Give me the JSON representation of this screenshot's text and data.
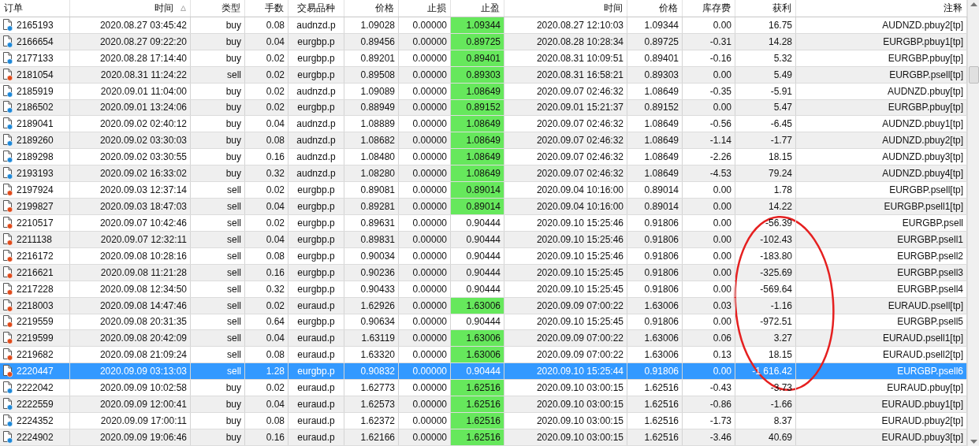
{
  "columns": [
    {
      "label": "订单",
      "sort": false
    },
    {
      "label": "时间",
      "sort": true
    },
    {
      "label": "类型",
      "sort": false
    },
    {
      "label": "手数",
      "sort": false
    },
    {
      "label": "交易品种",
      "sort": false
    },
    {
      "label": "价格",
      "sort": false
    },
    {
      "label": "止损",
      "sort": false
    },
    {
      "label": "止盈",
      "sort": false
    },
    {
      "label": "时间",
      "sort": false
    },
    {
      "label": "价格",
      "sort": false
    },
    {
      "label": "库存费",
      "sort": false
    },
    {
      "label": "获利",
      "sort": false
    },
    {
      "label": "注释",
      "sort": false
    }
  ],
  "rows": [
    {
      "kind": "buy",
      "tp_hit": true,
      "selected": false,
      "cells": [
        "2165193",
        "2020.08.27 03:45:42",
        "buy",
        "0.08",
        "audnzd.p",
        "1.09028",
        "0.00000",
        "1.09344",
        "2020.08.27 12:10:03",
        "1.09344",
        "0.00",
        "16.75",
        "AUDNZD.pbuy2[tp]"
      ]
    },
    {
      "kind": "buy",
      "tp_hit": true,
      "selected": false,
      "cells": [
        "2166654",
        "2020.08.27 09:22:20",
        "buy",
        "0.04",
        "eurgbp.p",
        "0.89456",
        "0.00000",
        "0.89725",
        "2020.08.28 10:28:34",
        "0.89725",
        "-0.31",
        "14.28",
        "EURGBP.pbuy1[tp]"
      ]
    },
    {
      "kind": "buy",
      "tp_hit": true,
      "selected": false,
      "cells": [
        "2177133",
        "2020.08.28 17:14:40",
        "buy",
        "0.02",
        "eurgbp.p",
        "0.89201",
        "0.00000",
        "0.89401",
        "2020.08.31 10:09:51",
        "0.89401",
        "-0.16",
        "5.32",
        "EURGBP.pbuy[tp]"
      ]
    },
    {
      "kind": "sell",
      "tp_hit": true,
      "selected": false,
      "cells": [
        "2181054",
        "2020.08.31 11:24:22",
        "sell",
        "0.02",
        "eurgbp.p",
        "0.89508",
        "0.00000",
        "0.89303",
        "2020.08.31 16:58:21",
        "0.89303",
        "0.00",
        "5.49",
        "EURGBP.psell[tp]"
      ]
    },
    {
      "kind": "buy",
      "tp_hit": true,
      "selected": false,
      "cells": [
        "2185919",
        "2020.09.01 11:04:00",
        "buy",
        "0.02",
        "audnzd.p",
        "1.09089",
        "0.00000",
        "1.08649",
        "2020.09.07 02:46:32",
        "1.08649",
        "-0.35",
        "-5.91",
        "AUDNZD.pbuy[tp]"
      ]
    },
    {
      "kind": "buy",
      "tp_hit": true,
      "selected": false,
      "cells": [
        "2186502",
        "2020.09.01 13:24:06",
        "buy",
        "0.02",
        "eurgbp.p",
        "0.88949",
        "0.00000",
        "0.89152",
        "2020.09.01 15:21:37",
        "0.89152",
        "0.00",
        "5.47",
        "EURGBP.pbuy[tp]"
      ]
    },
    {
      "kind": "buy",
      "tp_hit": true,
      "selected": false,
      "cells": [
        "2189041",
        "2020.09.02 02:40:12",
        "buy",
        "0.04",
        "audnzd.p",
        "1.08889",
        "0.00000",
        "1.08649",
        "2020.09.07 02:46:32",
        "1.08649",
        "-0.56",
        "-6.45",
        "AUDNZD.pbuy1[tp]"
      ]
    },
    {
      "kind": "buy",
      "tp_hit": true,
      "selected": false,
      "cells": [
        "2189260",
        "2020.09.02 03:30:03",
        "buy",
        "0.08",
        "audnzd.p",
        "1.08682",
        "0.00000",
        "1.08649",
        "2020.09.07 02:46:32",
        "1.08649",
        "-1.14",
        "-1.77",
        "AUDNZD.pbuy2[tp]"
      ]
    },
    {
      "kind": "buy",
      "tp_hit": true,
      "selected": false,
      "cells": [
        "2189298",
        "2020.09.02 03:30:55",
        "buy",
        "0.16",
        "audnzd.p",
        "1.08480",
        "0.00000",
        "1.08649",
        "2020.09.07 02:46:32",
        "1.08649",
        "-2.26",
        "18.15",
        "AUDNZD.pbuy3[tp]"
      ]
    },
    {
      "kind": "buy",
      "tp_hit": true,
      "selected": false,
      "cells": [
        "2193193",
        "2020.09.02 16:33:02",
        "buy",
        "0.32",
        "audnzd.p",
        "1.08280",
        "0.00000",
        "1.08649",
        "2020.09.07 02:46:32",
        "1.08649",
        "-4.53",
        "79.24",
        "AUDNZD.pbuy4[tp]"
      ]
    },
    {
      "kind": "sell",
      "tp_hit": true,
      "selected": false,
      "cells": [
        "2197924",
        "2020.09.03 12:37:14",
        "sell",
        "0.02",
        "eurgbp.p",
        "0.89081",
        "0.00000",
        "0.89014",
        "2020.09.04 10:16:00",
        "0.89014",
        "0.00",
        "1.78",
        "EURGBP.psell[tp]"
      ]
    },
    {
      "kind": "sell",
      "tp_hit": true,
      "selected": false,
      "cells": [
        "2199827",
        "2020.09.03 18:47:03",
        "sell",
        "0.04",
        "eurgbp.p",
        "0.89281",
        "0.00000",
        "0.89014",
        "2020.09.04 10:16:00",
        "0.89014",
        "0.00",
        "14.22",
        "EURGBP.psell1[tp]"
      ]
    },
    {
      "kind": "sell",
      "tp_hit": false,
      "selected": false,
      "cells": [
        "2210517",
        "2020.09.07 10:42:46",
        "sell",
        "0.02",
        "eurgbp.p",
        "0.89631",
        "0.00000",
        "0.90444",
        "2020.09.10 15:25:46",
        "0.91806",
        "0.00",
        "-56.39",
        "EURGBP.psell"
      ]
    },
    {
      "kind": "sell",
      "tp_hit": false,
      "selected": false,
      "cells": [
        "2211138",
        "2020.09.07 12:32:11",
        "sell",
        "0.04",
        "eurgbp.p",
        "0.89831",
        "0.00000",
        "0.90444",
        "2020.09.10 15:25:46",
        "0.91806",
        "0.00",
        "-102.43",
        "EURGBP.psell1"
      ]
    },
    {
      "kind": "sell",
      "tp_hit": false,
      "selected": false,
      "cells": [
        "2216172",
        "2020.09.08 10:28:16",
        "sell",
        "0.08",
        "eurgbp.p",
        "0.90034",
        "0.00000",
        "0.90444",
        "2020.09.10 15:25:46",
        "0.91806",
        "0.00",
        "-183.80",
        "EURGBP.psell2"
      ]
    },
    {
      "kind": "sell",
      "tp_hit": false,
      "selected": false,
      "cells": [
        "2216621",
        "2020.09.08 11:21:28",
        "sell",
        "0.16",
        "eurgbp.p",
        "0.90236",
        "0.00000",
        "0.90444",
        "2020.09.10 15:25:45",
        "0.91806",
        "0.00",
        "-325.69",
        "EURGBP.psell3"
      ]
    },
    {
      "kind": "sell",
      "tp_hit": false,
      "selected": false,
      "cells": [
        "2217228",
        "2020.09.08 12:34:50",
        "sell",
        "0.32",
        "eurgbp.p",
        "0.90433",
        "0.00000",
        "0.90444",
        "2020.09.10 15:25:45",
        "0.91806",
        "0.00",
        "-569.64",
        "EURGBP.psell4"
      ]
    },
    {
      "kind": "sell",
      "tp_hit": true,
      "selected": false,
      "cells": [
        "2218003",
        "2020.09.08 14:47:46",
        "sell",
        "0.02",
        "euraud.p",
        "1.62926",
        "0.00000",
        "1.63006",
        "2020.09.09 07:00:22",
        "1.63006",
        "0.03",
        "-1.16",
        "EURAUD.psell[tp]"
      ]
    },
    {
      "kind": "sell",
      "tp_hit": false,
      "selected": false,
      "cells": [
        "2219559",
        "2020.09.08 20:31:35",
        "sell",
        "0.64",
        "eurgbp.p",
        "0.90634",
        "0.00000",
        "0.90444",
        "2020.09.10 15:25:45",
        "0.91806",
        "0.00",
        "-972.51",
        "EURGBP.psell5"
      ]
    },
    {
      "kind": "sell",
      "tp_hit": true,
      "selected": false,
      "cells": [
        "2219599",
        "2020.09.08 20:42:09",
        "sell",
        "0.04",
        "euraud.p",
        "1.63119",
        "0.00000",
        "1.63006",
        "2020.09.09 07:00:22",
        "1.63006",
        "0.06",
        "3.27",
        "EURAUD.psell1[tp]"
      ]
    },
    {
      "kind": "sell",
      "tp_hit": true,
      "selected": false,
      "cells": [
        "2219682",
        "2020.09.08 21:09:24",
        "sell",
        "0.08",
        "euraud.p",
        "1.63320",
        "0.00000",
        "1.63006",
        "2020.09.09 07:00:22",
        "1.63006",
        "0.13",
        "18.15",
        "EURAUD.psell2[tp]"
      ]
    },
    {
      "kind": "sell",
      "tp_hit": false,
      "selected": true,
      "cells": [
        "2220447",
        "2020.09.09 03:13:03",
        "sell",
        "1.28",
        "eurgbp.p",
        "0.90832",
        "0.00000",
        "0.90444",
        "2020.09.10 15:25:44",
        "0.91806",
        "0.00",
        "-1 616.42",
        "EURGBP.psell6"
      ]
    },
    {
      "kind": "buy",
      "tp_hit": true,
      "selected": false,
      "cells": [
        "2222042",
        "2020.09.09 10:02:58",
        "buy",
        "0.02",
        "euraud.p",
        "1.62773",
        "0.00000",
        "1.62516",
        "2020.09.10 03:00:15",
        "1.62516",
        "-0.43",
        "-3.73",
        "EURAUD.pbuy[tp]"
      ]
    },
    {
      "kind": "buy",
      "tp_hit": true,
      "selected": false,
      "cells": [
        "2222559",
        "2020.09.09 12:00:41",
        "buy",
        "0.04",
        "euraud.p",
        "1.62573",
        "0.00000",
        "1.62516",
        "2020.09.10 03:00:15",
        "1.62516",
        "-0.86",
        "-1.66",
        "EURAUD.pbuy1[tp]"
      ]
    },
    {
      "kind": "buy",
      "tp_hit": true,
      "selected": false,
      "cells": [
        "2224352",
        "2020.09.09 17:00:11",
        "buy",
        "0.08",
        "euraud.p",
        "1.62372",
        "0.00000",
        "1.62516",
        "2020.09.10 03:00:15",
        "1.62516",
        "-1.73",
        "8.37",
        "EURAUD.pbuy2[tp]"
      ]
    },
    {
      "kind": "buy",
      "tp_hit": true,
      "selected": false,
      "cells": [
        "2224902",
        "2020.09.09 19:06:46",
        "buy",
        "0.16",
        "euraud.p",
        "1.62166",
        "0.00000",
        "1.62516",
        "2020.09.10 03:00:15",
        "1.62516",
        "-3.46",
        "40.69",
        "EURAUD.pbuy3[tp]"
      ]
    }
  ]
}
